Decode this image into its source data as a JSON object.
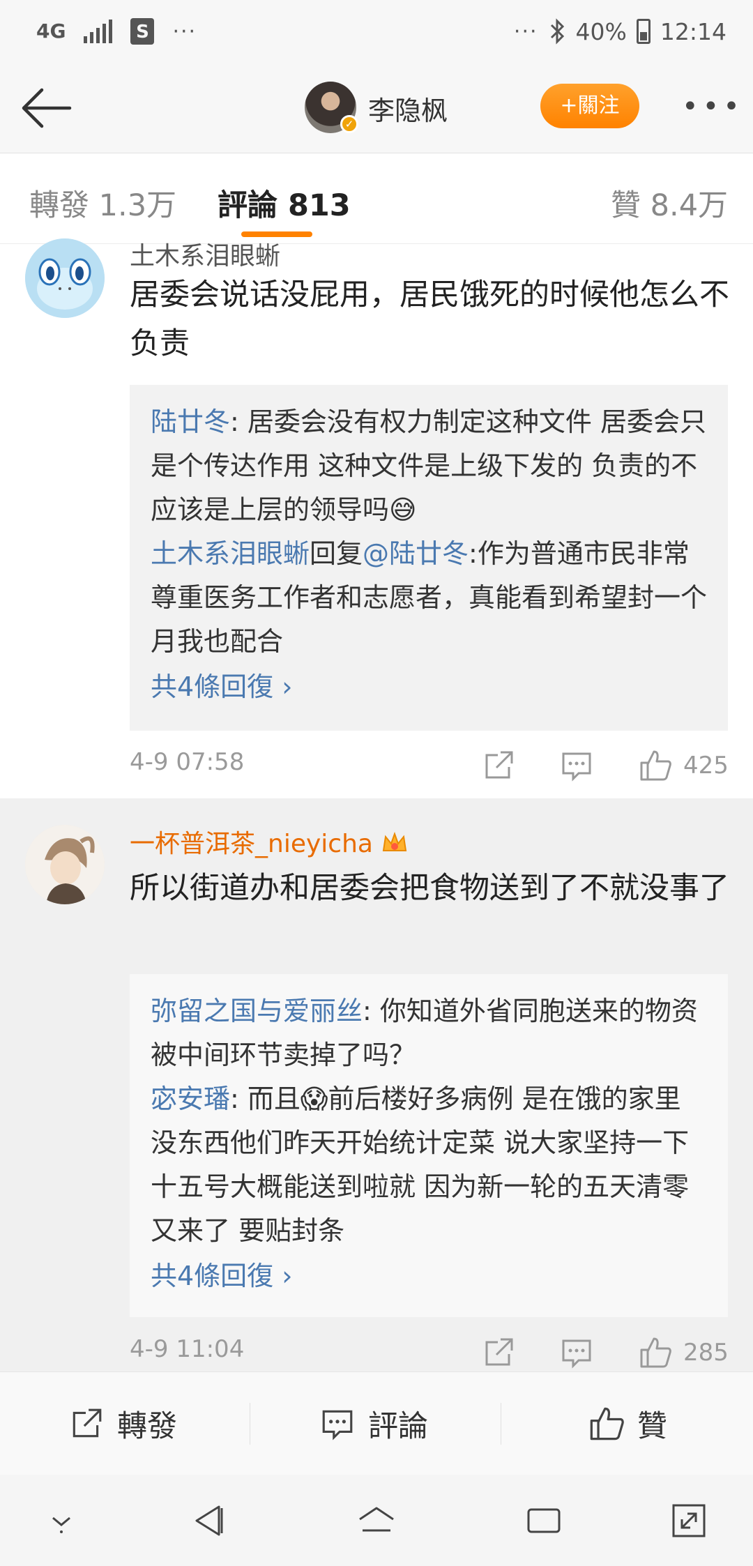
{
  "status_bar": {
    "network": "4G",
    "battery": "40%",
    "time": "12:14",
    "overflow": "···"
  },
  "header": {
    "username": "李隐枫",
    "follow_label": "+關注"
  },
  "tabs": {
    "repost": "轉發 1.3万",
    "comments": "評論 813",
    "likes": "贊 8.4万"
  },
  "comments": [
    {
      "author": "土木系泪眼蜥",
      "text": "居委会说话没屁用，居民饿死的时候他怎么不负责",
      "replies": [
        {
          "name": "陆廿冬",
          "sep": ": ",
          "body": "居委会没有权力制定这种文件 居委会只是个传达作用 这种文件是上级下发的 负责的不应该是上层的领导吗😅"
        },
        {
          "name": "土木系泪眼蜥",
          "sep": "回复",
          "mention": "@陆廿冬",
          "body": ":作为普通市民非常尊重医务工作者和志愿者，真能看到希望封一个月我也配合"
        }
      ],
      "more_replies": "共4條回復 ›",
      "time": "4-9 07:58",
      "likes": "425"
    },
    {
      "author": "一杯普洱茶_nieyicha",
      "text": "所以街道办和居委会把食物送到了不就没事了",
      "replies": [
        {
          "name": "弥留之国与爱丽丝",
          "sep": ": ",
          "body": "你知道外省同胞送来的物资被中间环节卖掉了吗？"
        },
        {
          "name": "宓安璠",
          "sep": ": ",
          "body": "而且😱前后楼好多病例 是在饿的家里没东西他们昨天开始统计定菜 说大家坚持一下十五号大概能送到啦就 因为新一轮的五天清零又来了 要贴封条"
        }
      ],
      "more_replies": "共4條回復 ›",
      "time": "4-9 11:04",
      "likes": "285"
    }
  ],
  "bottom_bar": {
    "repost": "轉發",
    "comment": "評論",
    "like": "贊"
  },
  "colors": {
    "accent": "#ff8200",
    "link": "#4a79b0",
    "vip_name": "#e86b00"
  }
}
